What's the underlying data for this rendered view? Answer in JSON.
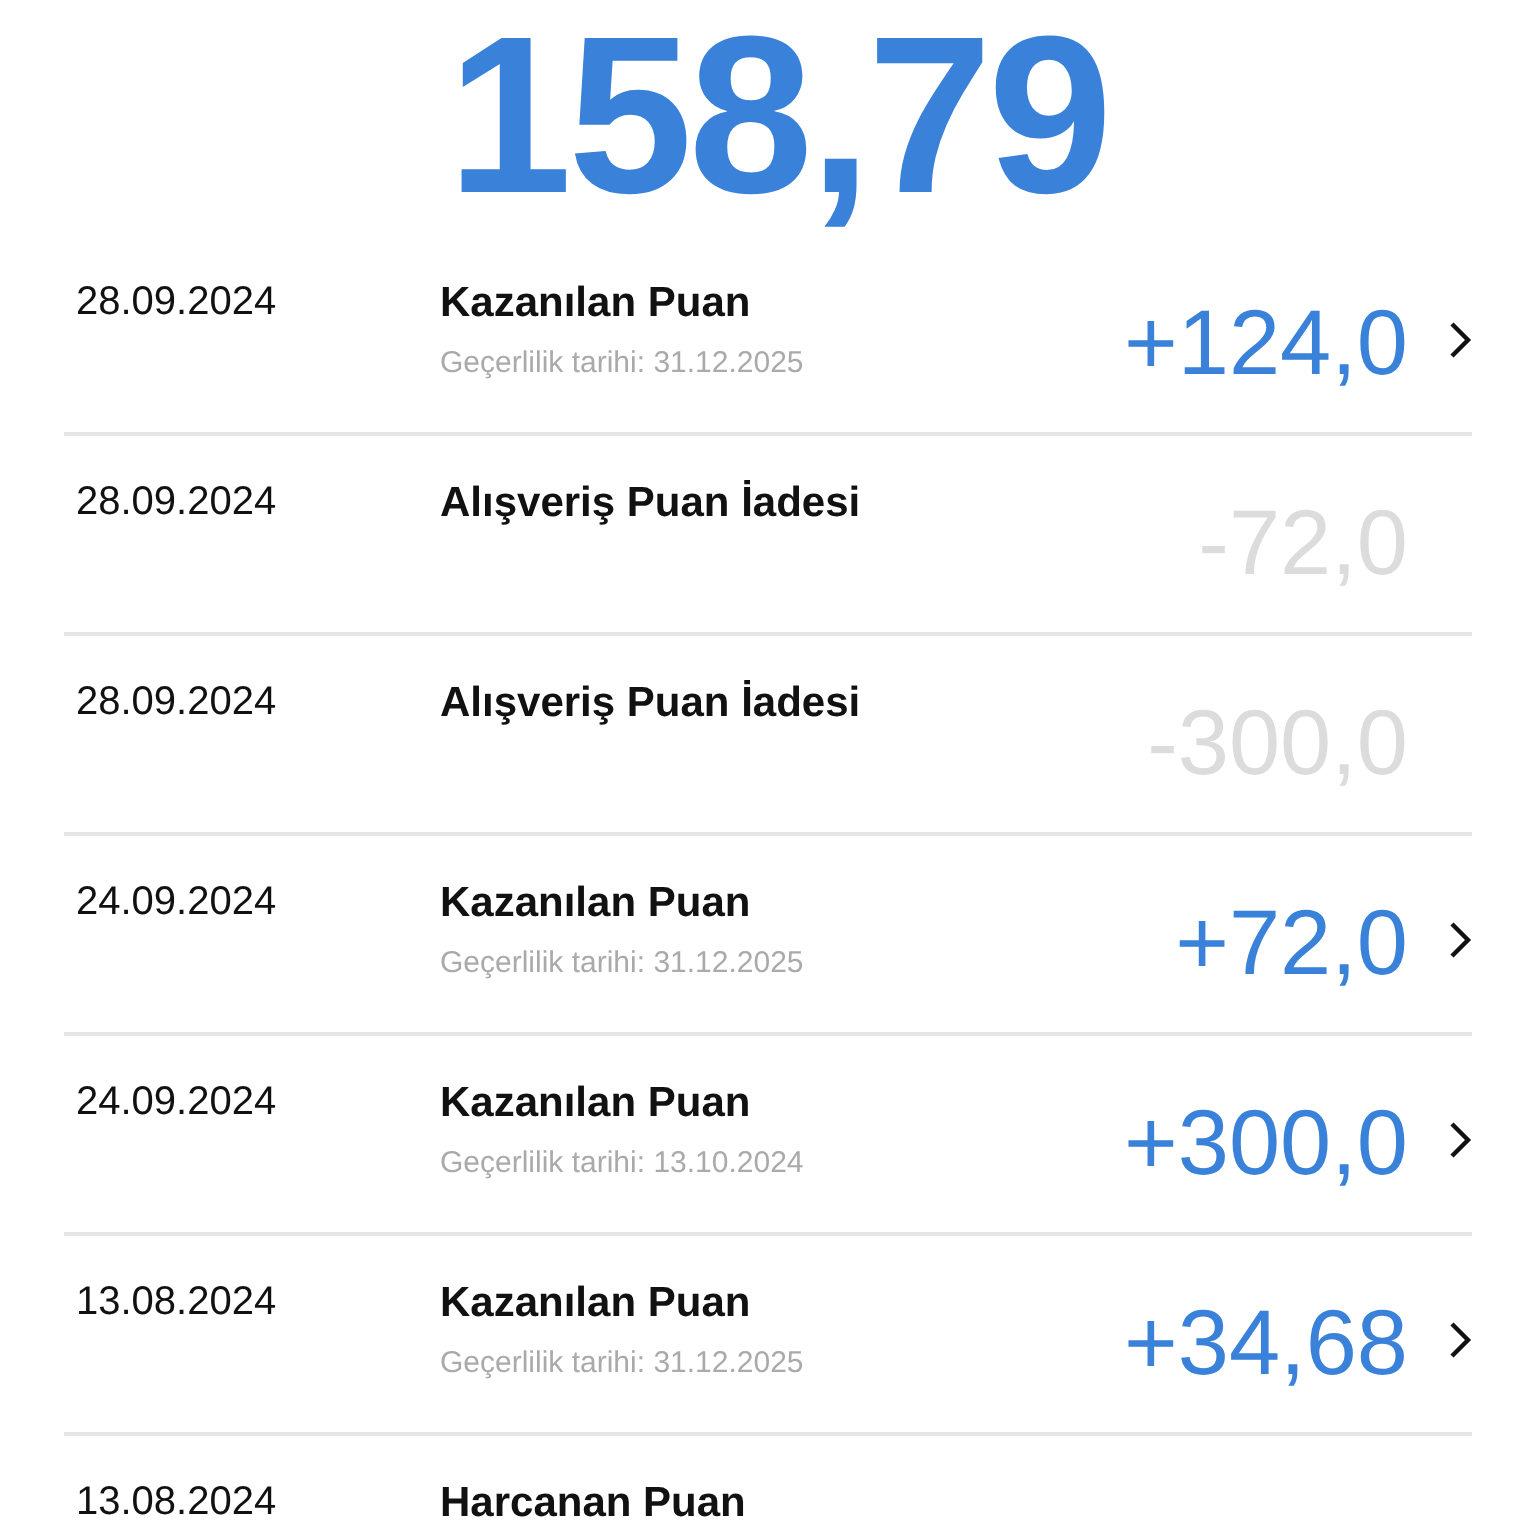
{
  "balance": "158,79",
  "transactions": [
    {
      "date": "28.09.2024",
      "title": "Kazanılan Puan",
      "validity": "Geçerlilik tarihi: 31.12.2025",
      "amount": "+124,0",
      "kind": "earned",
      "has_detail": true
    },
    {
      "date": "28.09.2024",
      "title": "Alışveriş Puan İadesi",
      "amount": "-72,0",
      "kind": "refund",
      "has_detail": false
    },
    {
      "date": "28.09.2024",
      "title": "Alışveriş Puan İadesi",
      "amount": "-300,0",
      "kind": "refund",
      "has_detail": false
    },
    {
      "date": "24.09.2024",
      "title": "Kazanılan Puan",
      "validity": "Geçerlilik tarihi: 31.12.2025",
      "amount": "+72,0",
      "kind": "earned",
      "has_detail": true
    },
    {
      "date": "24.09.2024",
      "title": "Kazanılan Puan",
      "validity": "Geçerlilik tarihi: 13.10.2024",
      "amount": "+300,0",
      "kind": "earned",
      "has_detail": true
    },
    {
      "date": "13.08.2024",
      "title": "Kazanılan Puan",
      "validity": "Geçerlilik tarihi: 31.12.2025",
      "amount": "+34,68",
      "kind": "earned",
      "has_detail": true
    },
    {
      "date": "13.08.2024",
      "title": "Harcanan Puan"
    }
  ]
}
